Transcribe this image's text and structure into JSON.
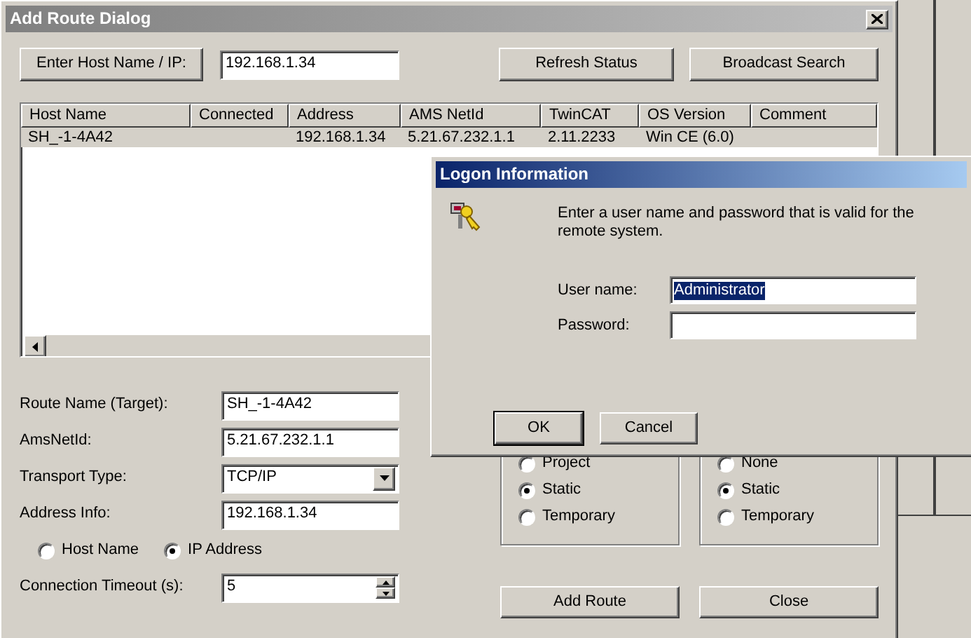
{
  "main_window": {
    "title": "Add Route Dialog",
    "host_button": "Enter Host Name / IP:",
    "host_value": "192.168.1.34",
    "buttons": [
      "Refresh Status",
      "Broadcast Search"
    ]
  },
  "host_table": {
    "columns": [
      "Host Name",
      "Connected",
      "Address",
      "AMS NetId",
      "TwinCAT",
      "OS Version",
      "Comment"
    ],
    "rows": [
      {
        "cells": [
          "SH_-1-4A42",
          "",
          "192.168.1.34",
          "5.21.67.232.1.1",
          "2.11.2233",
          "Win CE (6.0)",
          ""
        ],
        "selected": true
      }
    ]
  },
  "route_form": {
    "fields": [
      {
        "kind": "text",
        "label": "Route Name (Target):",
        "value": "SH_-1-4A42"
      },
      {
        "kind": "text",
        "label": "AmsNetId:",
        "value": "5.21.67.232.1.1"
      },
      {
        "kind": "dropdown",
        "label": "Transport Type:",
        "value": "TCP/IP"
      },
      {
        "kind": "text",
        "label": "Address Info:",
        "value": "192.168.1.34"
      },
      {
        "kind": "radios",
        "options": [
          {
            "label": "Host Name",
            "selected": false
          },
          {
            "label": "IP Address",
            "selected": true
          }
        ]
      },
      {
        "kind": "spinner",
        "label": "Connection Timeout (s):",
        "value": "5"
      }
    ]
  },
  "route_groups": [
    {
      "options": [
        {
          "label": "Project",
          "selected": false
        },
        {
          "label": "Static",
          "selected": true
        },
        {
          "label": "Temporary",
          "selected": false
        }
      ]
    },
    {
      "options": [
        {
          "label": "None",
          "selected": false
        },
        {
          "label": "Static",
          "selected": true
        },
        {
          "label": "Temporary",
          "selected": false
        }
      ]
    }
  ],
  "action_buttons": [
    "Add Route",
    "Close"
  ],
  "logon_dialog": {
    "title": "Logon Information",
    "message": "Enter a user name and password that is valid for the remote system.",
    "fields": [
      {
        "label": "User name:",
        "value": "Administrator",
        "text_selected": true
      },
      {
        "label": "Password:"
      }
    ],
    "buttons": [
      {
        "label": "OK",
        "default": true
      },
      {
        "label": "Cancel",
        "default": false
      }
    ]
  }
}
